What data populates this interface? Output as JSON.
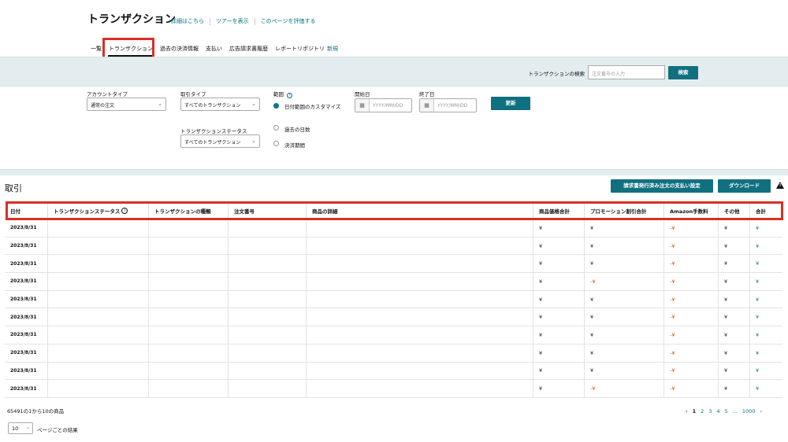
{
  "header": {
    "title": "トランザクション",
    "links": [
      "詳細はこちら",
      "ツアーを表示",
      "このページを評価する"
    ],
    "tabs": [
      "一覧",
      "トランザクション",
      "過去の決済情報",
      "支払い",
      "広告請求書履歴",
      "レポートリポジトリ"
    ],
    "new_badge": "新規",
    "active_tab": "トランザクション"
  },
  "search": {
    "label": "トランザクションの検索",
    "placeholder": "注文番号の入力",
    "button": "検索"
  },
  "filters": {
    "account_type_label": "アカウントタイプ",
    "account_type_value": "通常の注文",
    "transaction_type_label": "取引タイプ",
    "transaction_type_value": "すべてのトランザクション",
    "transaction_status_label": "トランザクションステータス",
    "transaction_status_value": "すべてのトランザクション",
    "range_label": "範囲",
    "range_options": [
      "日付範囲のカスタマイズ",
      "過去の日数",
      "決済期間"
    ],
    "start_label": "開始日",
    "end_label": "終了日",
    "date_placeholder": "YYYY/MM/DD",
    "update_button": "更新"
  },
  "section": {
    "title": "取引",
    "invoice_button": "請求書発行済み注文の支払い設定",
    "download_button": "ダウンロード"
  },
  "table": {
    "columns": [
      "日付",
      "トランザクションステータス",
      "トランザクションの種類",
      "注文番号",
      "商品の詳細",
      "商品価格合計",
      "プロモーション割引合計",
      "Amazon手数料",
      "その他",
      "合計"
    ],
    "rows": [
      {
        "date": "2023/8/31",
        "price": "¥",
        "promo": "¥",
        "fee": "-¥",
        "other": "¥",
        "total": "¥",
        "promo_neg": false
      },
      {
        "date": "2023/8/31",
        "price": "¥",
        "promo": "¥",
        "fee": "-¥",
        "other": "¥",
        "total": "¥",
        "promo_neg": false
      },
      {
        "date": "2023/8/31",
        "price": "¥",
        "promo": "¥",
        "fee": "-¥",
        "other": "¥",
        "total": "¥",
        "promo_neg": false
      },
      {
        "date": "2023/8/31",
        "price": "¥",
        "promo": "-¥",
        "fee": "-¥",
        "other": "¥",
        "total": "¥",
        "promo_neg": true
      },
      {
        "date": "2023/8/31",
        "price": "¥",
        "promo": "¥",
        "fee": "-¥",
        "other": "¥",
        "total": "¥",
        "promo_neg": false
      },
      {
        "date": "2023/8/31",
        "price": "¥",
        "promo": "¥",
        "fee": "-¥",
        "other": "¥",
        "total": "¥",
        "promo_neg": false
      },
      {
        "date": "2023/8/31",
        "price": "¥",
        "promo": "¥",
        "fee": "-¥",
        "other": "¥",
        "total": "¥",
        "promo_neg": false
      },
      {
        "date": "2023/8/31",
        "price": "¥",
        "promo": "¥",
        "fee": "-¥",
        "other": "¥",
        "total": "¥",
        "promo_neg": false
      },
      {
        "date": "2023/8/31",
        "price": "¥",
        "promo": "¥",
        "fee": "-¥",
        "other": "¥",
        "total": "¥",
        "promo_neg": false
      },
      {
        "date": "2023/8/31",
        "price": "¥",
        "promo": "-¥",
        "fee": "-¥",
        "other": "¥",
        "total": "¥",
        "promo_neg": true
      }
    ]
  },
  "footer": {
    "count_text": "65491の1から10の商品",
    "per_page_value": "10",
    "per_page_label": "ページごとの結果",
    "pages": [
      "1",
      "2",
      "3",
      "4",
      "5",
      "...",
      "1000"
    ],
    "current_page": "1",
    "prev": "‹",
    "next": "›"
  },
  "colors": {
    "accent": "#107080",
    "link": "#007185",
    "highlight": "#d93025",
    "negative": "#d14a00",
    "band": "#e3ecee"
  }
}
